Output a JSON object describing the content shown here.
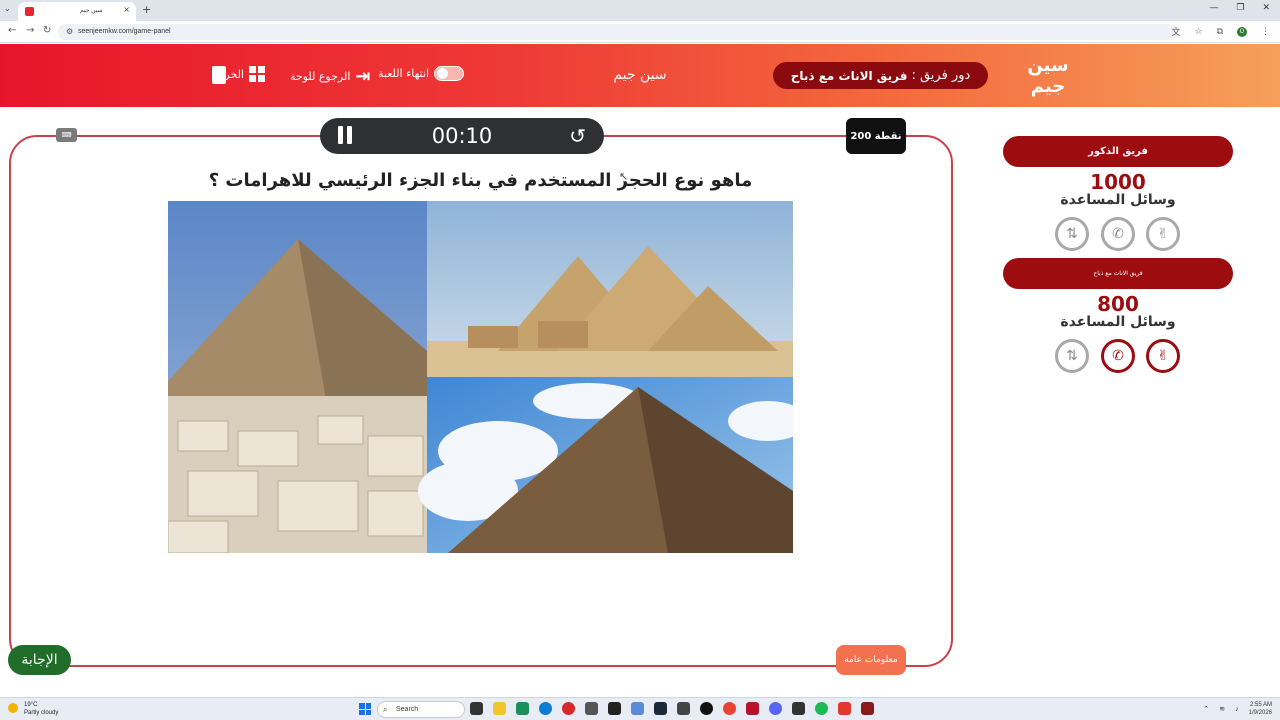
{
  "browser": {
    "tab_title": "سين جيم",
    "url": "seenjeemkw.com/game-panel",
    "tab_close": "×",
    "new_tab": "+",
    "profile_initial": "O"
  },
  "header": {
    "logo_text": "سين جيم",
    "turn_label": "دور فريق :",
    "turn_team": "فريق الاناث مع ذباح",
    "game_name": "سين جيم",
    "end_game": "انتهاء اللعبة",
    "back_to_board": "الرجوع للوحة",
    "exit": "الخروج"
  },
  "teams": [
    {
      "name": "فريق الذكور",
      "score": "1000",
      "helps_label": "وسائل المساعدة"
    },
    {
      "name": "فريق الاناث مع ذباح",
      "score": "800",
      "helps_label": "وسائل المساعدة"
    }
  ],
  "game": {
    "timer": "00:10",
    "points": "200 نقطة",
    "question": "ماهو نوع الحجر المستخدم في بناء الجزء الرئيسي للاهرامات ؟",
    "info_button": "معلومات عامة",
    "answer_button": "الإجابة"
  },
  "taskbar": {
    "weather_temp": "19°C",
    "weather_desc": "Partly cloudy",
    "search_placeholder": "Search",
    "time": "2:55 AM",
    "date": "1/9/2026"
  },
  "colors": {
    "accent_dark_red": "#9d0d10",
    "header_red": "#e8152a",
    "header_orange": "#f5a05a",
    "answer_green": "#1f6d28",
    "info_orange": "#f4714f",
    "board_border": "#c8424a"
  },
  "icons": {
    "pause": "pause-icon",
    "reset": "history-icon",
    "phone": "phone-icon",
    "peace": "peace-hand-icon",
    "swap": "swap-icon"
  }
}
